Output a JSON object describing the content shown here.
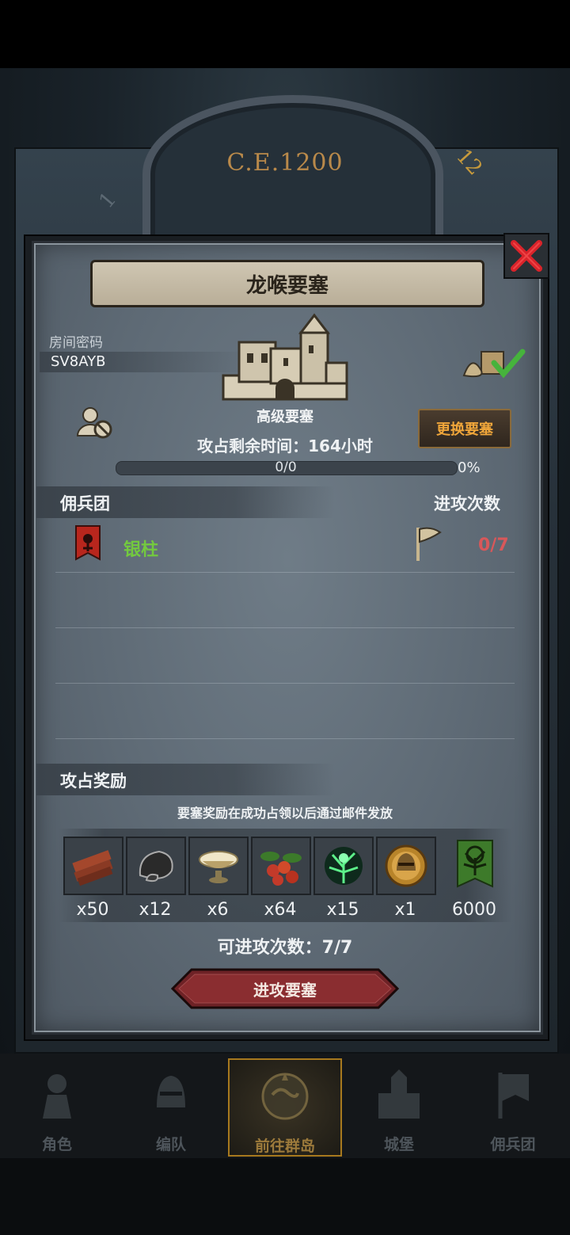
{
  "background": {
    "era_text": "C.E.1200",
    "dial_numbers": [
      "12",
      "1"
    ]
  },
  "dialog": {
    "title": "龙喉要塞",
    "room": {
      "label": "房间密码",
      "code": "SV8AYB"
    },
    "fortress": {
      "type": "高级要塞",
      "remaining_label": "攻占剩余时间：164小时",
      "progress": {
        "text": "0/0",
        "percent_text": "0%",
        "value": 0
      }
    },
    "change_button": "更换要塞",
    "mercenary_section": {
      "left": "佣兵团",
      "right": "进攻次数"
    },
    "guilds": [
      {
        "name": "银柱",
        "count": "0/7"
      }
    ],
    "reward_section": {
      "title": "攻占奖励",
      "hint": "要塞奖励在成功占领以后通过邮件发放",
      "items": [
        {
          "icon": "wood-icon",
          "qty": "x50"
        },
        {
          "icon": "ore-icon",
          "qty": "x12"
        },
        {
          "icon": "bowl-icon",
          "qty": "x6"
        },
        {
          "icon": "berries-icon",
          "qty": "x64"
        },
        {
          "icon": "tree-spirit-icon",
          "qty": "x15"
        },
        {
          "icon": "helmet-medal-icon",
          "qty": "x1"
        },
        {
          "icon": "guild-banner-icon",
          "qty": "6000"
        }
      ]
    },
    "attempts": "可进攻次数：7/7",
    "attack_button": "进攻要塞"
  },
  "nav": {
    "items": [
      {
        "label": "角色",
        "icon": "knight-icon"
      },
      {
        "label": "编队",
        "icon": "helmet-icon"
      },
      {
        "label": "前往群岛",
        "icon": "compass-icon",
        "active": true
      },
      {
        "label": "城堡",
        "icon": "castle-icon"
      },
      {
        "label": "佣兵团",
        "icon": "banner-icon"
      }
    ]
  },
  "colors": {
    "panel": "#5e6a75",
    "accent_gold": "#f0a63a",
    "guild_green": "#73c93f",
    "count_red": "#d8585a",
    "attack_red": "#6e2226"
  }
}
